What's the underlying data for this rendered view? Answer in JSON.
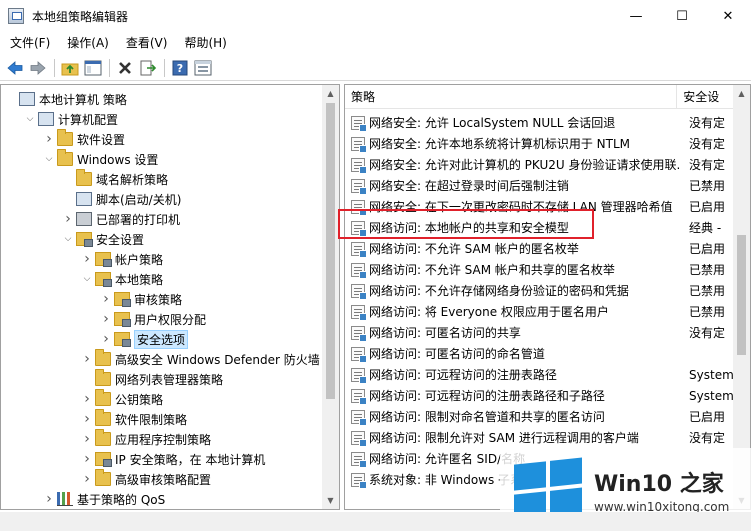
{
  "window": {
    "title": "本地组策略编辑器",
    "minimize": "—",
    "maximize": "☐",
    "close": "✕"
  },
  "menu": [
    "文件(F)",
    "操作(A)",
    "查看(V)",
    "帮助(H)"
  ],
  "toolbar": [
    "back-icon",
    "forward-icon",
    "up-icon",
    "show-tree-icon",
    "delete-icon",
    "export-icon",
    "help-icon",
    "properties-icon"
  ],
  "tree": [
    {
      "label": "本地计算机 策略",
      "depth": 0,
      "exp": "",
      "icon": "computer"
    },
    {
      "label": "计算机配置",
      "depth": 1,
      "exp": "v",
      "icon": "computer"
    },
    {
      "label": "软件设置",
      "depth": 2,
      "exp": ">",
      "icon": "folder"
    },
    {
      "label": "Windows 设置",
      "depth": 2,
      "exp": "v",
      "icon": "folder"
    },
    {
      "label": "域名解析策略",
      "depth": 3,
      "exp": "",
      "icon": "folder"
    },
    {
      "label": "脚本(启动/关机)",
      "depth": 3,
      "exp": "",
      "icon": "doc"
    },
    {
      "label": "已部署的打印机",
      "depth": 3,
      "exp": ">",
      "icon": "printer"
    },
    {
      "label": "安全设置",
      "depth": 3,
      "exp": "v",
      "icon": "lockf"
    },
    {
      "label": "帐户策略",
      "depth": 4,
      "exp": ">",
      "icon": "lockf"
    },
    {
      "label": "本地策略",
      "depth": 4,
      "exp": "v",
      "icon": "lockf"
    },
    {
      "label": "审核策略",
      "depth": 5,
      "exp": ">",
      "icon": "lockf"
    },
    {
      "label": "用户权限分配",
      "depth": 5,
      "exp": ">",
      "icon": "lockf"
    },
    {
      "label": "安全选项",
      "depth": 5,
      "exp": ">",
      "icon": "lockf",
      "selected": true
    },
    {
      "label": "高级安全 Windows Defender 防火墙",
      "depth": 4,
      "exp": ">",
      "icon": "folder"
    },
    {
      "label": "网络列表管理器策略",
      "depth": 4,
      "exp": "",
      "icon": "folder"
    },
    {
      "label": "公钥策略",
      "depth": 4,
      "exp": ">",
      "icon": "folder"
    },
    {
      "label": "软件限制策略",
      "depth": 4,
      "exp": ">",
      "icon": "folder"
    },
    {
      "label": "应用程序控制策略",
      "depth": 4,
      "exp": ">",
      "icon": "folder"
    },
    {
      "label": "IP 安全策略，在 本地计算机",
      "depth": 4,
      "exp": ">",
      "icon": "lockf"
    },
    {
      "label": "高级审核策略配置",
      "depth": 4,
      "exp": ">",
      "icon": "folder"
    },
    {
      "label": "基于策略的 QoS",
      "depth": 2,
      "exp": ">",
      "icon": "chart"
    }
  ],
  "list": {
    "col_policy": "策略",
    "col_setting": "安全设",
    "rows": [
      {
        "policy": "网络安全: 允许 LocalSystem NULL 会话回退",
        "setting": "没有定"
      },
      {
        "policy": "网络安全: 允许本地系统将计算机标识用于 NTLM",
        "setting": "没有定"
      },
      {
        "policy": "网络安全: 允许对此计算机的 PKU2U 身份验证请求使用联...",
        "setting": "没有定"
      },
      {
        "policy": "网络安全: 在超过登录时间后强制注销",
        "setting": "已禁用"
      },
      {
        "policy": "网络安全: 在下一次更改密码时不存储 LAN 管理器哈希值",
        "setting": "已启用"
      },
      {
        "policy": "网络访问: 本地帐户的共享和安全模型",
        "setting": "经典 -"
      },
      {
        "policy": "网络访问: 不允许 SAM 帐户的匿名枚举",
        "setting": "已启用"
      },
      {
        "policy": "网络访问: 不允许 SAM 帐户和共享的匿名枚举",
        "setting": "已禁用"
      },
      {
        "policy": "网络访问: 不允许存储网络身份验证的密码和凭据",
        "setting": "已禁用"
      },
      {
        "policy": "网络访问: 将 Everyone 权限应用于匿名用户",
        "setting": "已禁用"
      },
      {
        "policy": "网络访问: 可匿名访问的共享",
        "setting": "没有定"
      },
      {
        "policy": "网络访问: 可匿名访问的命名管道",
        "setting": ""
      },
      {
        "policy": "网络访问: 可远程访问的注册表路径",
        "setting": "System"
      },
      {
        "policy": "网络访问: 可远程访问的注册表路径和子路径",
        "setting": "System"
      },
      {
        "policy": "网络访问: 限制对命名管道和共享的匿名访问",
        "setting": "已启用"
      },
      {
        "policy": "网络访问: 限制允许对 SAM 进行远程调用的客户端",
        "setting": "没有定"
      },
      {
        "policy": "网络访问: 允许匿名 SID/名称",
        "setting": ""
      },
      {
        "policy": "系统对象: 非 Windows 子系",
        "setting": ""
      }
    ]
  },
  "watermark": {
    "title": "Win10 之家",
    "url": "www.win10xitong.com"
  }
}
